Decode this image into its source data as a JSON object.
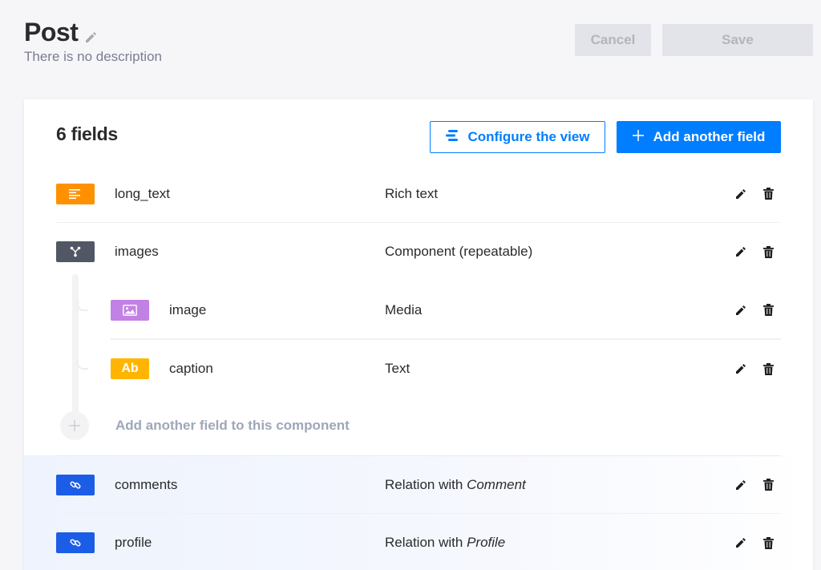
{
  "header": {
    "title": "Post",
    "description": "There is no description",
    "cancel_label": "Cancel",
    "save_label": "Save"
  },
  "content": {
    "fields_count": "6 fields",
    "configure_label": "Configure the view",
    "add_field_label": "Add another field",
    "add_component_field_label": "Add another field to this component"
  },
  "fields": [
    {
      "name": "long_text",
      "type": "Rich text",
      "icon": "rich-text-icon",
      "color": "#ff9100"
    },
    {
      "name": "images",
      "type": "Component (repeatable)",
      "icon": "component-icon",
      "color": "#515764"
    },
    {
      "name": "comments",
      "type_prefix": "Relation with",
      "type_target": "Comment",
      "icon": "relation-icon",
      "color": "#1c5de7"
    },
    {
      "name": "profile",
      "type_prefix": "Relation with",
      "type_target": "Profile",
      "icon": "relation-icon",
      "color": "#1c5de7"
    }
  ],
  "component_fields": [
    {
      "name": "image",
      "type": "Media",
      "icon": "media-icon",
      "color": "#c281e4"
    },
    {
      "name": "caption",
      "type": "Text",
      "badge": "Ab",
      "icon": "text-icon",
      "color": "#ffb500"
    }
  ],
  "colors": {
    "accent": "#007eff",
    "background": "#f6f6f9"
  }
}
